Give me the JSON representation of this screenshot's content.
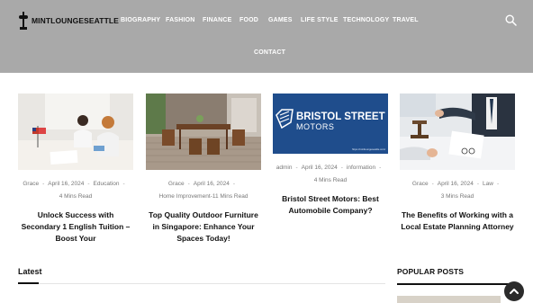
{
  "site": {
    "logo_text": "MINTLOUNGESEATTLE"
  },
  "nav": {
    "items": [
      "BIOGRAPHY",
      "FASHION",
      "FINANCE",
      "FOOD",
      "GAMES",
      "LIFE STYLE",
      "TECHNOLOGY",
      "TRAVEL"
    ],
    "contact": "CONTACT"
  },
  "cards": [
    {
      "author": "Grace",
      "date": "April 16, 2024",
      "category": "Education",
      "read_time": "4 Mins Read",
      "title": "Unlock Success with Secondary 1 English Tuition – Boost Your"
    },
    {
      "author": "Grace",
      "date": "April 16, 2024",
      "category": "Home Improvement",
      "read_time": "11 Mins Read",
      "title": "Top Quality Outdoor Furniture in Singapore: Enhance Your Spaces Today!"
    },
    {
      "author": "admin",
      "date": "April 16, 2024",
      "category": "information",
      "read_time": "4 Mins Read",
      "title": "Bristol Street Motors: Best Automobile Company?",
      "image_text": {
        "line1": "BRISTOL STREET",
        "line2": "MOTORS",
        "url": "https://mintloungeseattle.com/"
      }
    },
    {
      "author": "Grace",
      "date": "April 16, 2024",
      "category": "Law",
      "read_time": "3 Mins Read",
      "title": "The Benefits of Working with a Local Estate Planning Attorney"
    }
  ],
  "sections": {
    "latest": "Latest",
    "popular": "POPULAR POSTS"
  },
  "colors": {
    "header_bg": "#a9a9a9",
    "bristol_blue": "#1f4d8c",
    "scroll_btn": "#2b2b2b"
  },
  "icons": {
    "search": "search-icon",
    "scroll_top": "chevron-up-icon"
  }
}
